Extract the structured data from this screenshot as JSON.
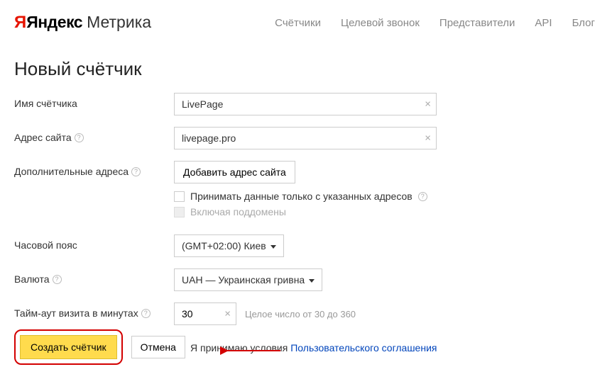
{
  "logo": {
    "yandex": "Яндекс",
    "metrika": "Метрика"
  },
  "nav": {
    "counters": "Счётчики",
    "target_call": "Целевой звонок",
    "representatives": "Представители",
    "api": "API",
    "blog": "Блог"
  },
  "page_title": "Новый счётчик",
  "labels": {
    "counter_name": "Имя счётчика",
    "site_address": "Адрес сайта",
    "additional_addresses": "Дополнительные адреса",
    "timezone": "Часовой пояс",
    "currency": "Валюта",
    "timeout": "Тайм-аут визита в минутах"
  },
  "fields": {
    "counter_name": "LivePage",
    "site_address": "livepage.pro",
    "timezone": "(GMT+02:00) Киев",
    "currency": "UAH — Украинская гривна",
    "timeout": "30"
  },
  "buttons": {
    "add_site_address": "Добавить адрес сайта",
    "create": "Создать счётчик",
    "cancel": "Отмена"
  },
  "checkboxes": {
    "accept_only_specified": "Принимать данные только с указанных адресов",
    "include_subdomains": "Включая поддомены",
    "accept_terms": "Я принимаю условия"
  },
  "hints": {
    "timeout": "Целое число от 30 до 360"
  },
  "links": {
    "user_agreement": "Пользовательского соглашения"
  }
}
